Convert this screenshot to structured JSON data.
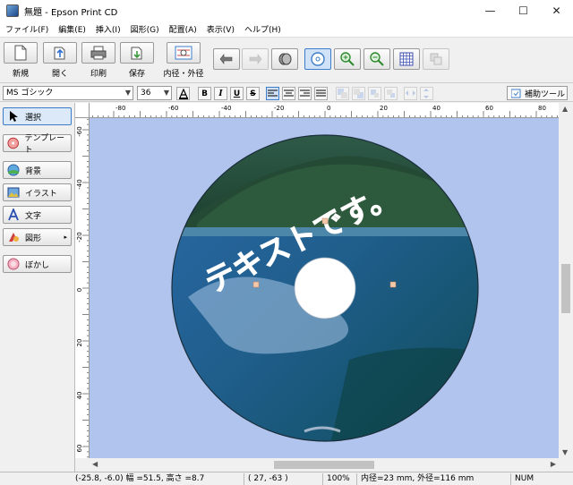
{
  "window": {
    "title": "無題 - Epson Print CD",
    "minimize": "—",
    "maximize": "☐",
    "close": "✕"
  },
  "menu": [
    "ファイル(F)",
    "編集(E)",
    "挿入(I)",
    "図形(G)",
    "配置(A)",
    "表示(V)",
    "ヘルプ(H)"
  ],
  "toolbar": {
    "new_label": "新規",
    "open_label": "開く",
    "print_label": "印刷",
    "save_label": "保存",
    "diameter_label": "内径・外径"
  },
  "format": {
    "font": "MS ゴシック",
    "size": "36",
    "bold": "B",
    "italic": "I",
    "underline": "U",
    "strike": "S",
    "assist_label": "補助ツール"
  },
  "sidebar": {
    "select": "選択",
    "template": "テンプレート",
    "background": "背景",
    "illustration": "イラスト",
    "text": "文字",
    "shape": "図形",
    "blur": "ぼかし"
  },
  "ruler": {
    "h_ticks": [
      "-80",
      "-60",
      "-40",
      "-20",
      "0",
      "20",
      "40",
      "60",
      "80"
    ],
    "v_ticks": [
      "-60",
      "-40",
      "-20",
      "0",
      "20",
      "40",
      "60"
    ]
  },
  "canvas": {
    "disc_text": "テキストです。"
  },
  "status": {
    "selection": "(-25.8, -6.0) 幅 =51.5, 高さ =8.7",
    "cursor": "( 27, -63 )",
    "zoom": "100%",
    "diameters": "内径=23 mm, 外径=116 mm",
    "numlock": "NUM"
  },
  "colors": {
    "canvas_bg": "#b0c4ee",
    "accent": "#3d7cc9"
  }
}
